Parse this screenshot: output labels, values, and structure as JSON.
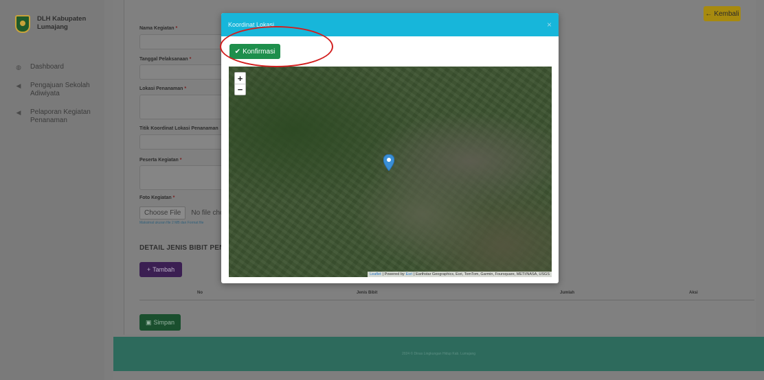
{
  "sidebar": {
    "brand": "DLH Kabupaten Lumajang",
    "items": [
      {
        "label": "Dashboard",
        "icon": "dashboard-icon"
      },
      {
        "label": "Pengajuan Sekolah Adiwiyata",
        "icon": "send-icon"
      },
      {
        "label": "Pelaporan Kegiatan Penanaman",
        "icon": "send-icon"
      }
    ]
  },
  "header": {
    "back_label": "Kembali"
  },
  "form": {
    "nama_kegiatan": "Nama Kegiatan",
    "tanggal": "Tanggal Pelaksanaan",
    "lokasi": "Lokasi Penanaman",
    "koordinat": "Titik Koordinat Lokasi Penanaman",
    "peserta": "Peserta Kegiatan",
    "foto": "Foto Kegiatan",
    "required_mark": "*",
    "choose_file": "Choose File",
    "no_file": "No file cho",
    "hint": "Maksimal ukuran file 2 MB dan Format file"
  },
  "detail": {
    "section_title": "DETAIL JENIS BIBIT PENA",
    "add_label": "Tambah",
    "columns": [
      "No",
      "Jenis Bibit",
      "Jumlah",
      "Aksi"
    ],
    "save_label": "Simpan"
  },
  "footer": {
    "text": "2024 © Dinas Lingkungan Hidup Kab. Lumajang"
  },
  "modal": {
    "title": "Koordinat Lokasi",
    "close": "×",
    "confirm_label": "Konfirmasi",
    "map": {
      "zoom_in": "+",
      "zoom_out": "−",
      "attribution_leaflet": "Leaflet",
      "attribution_text": "| Powered by",
      "attribution_esri": "Esri",
      "attribution_sources": "| Earthstar Geographics, Esri, TomTom, Garmin, Foursquare, METI/NASA, USGS"
    }
  },
  "colors": {
    "modal_header": "#17b6da",
    "confirm": "#1e8f4c",
    "highlight": "#d21f1f"
  }
}
